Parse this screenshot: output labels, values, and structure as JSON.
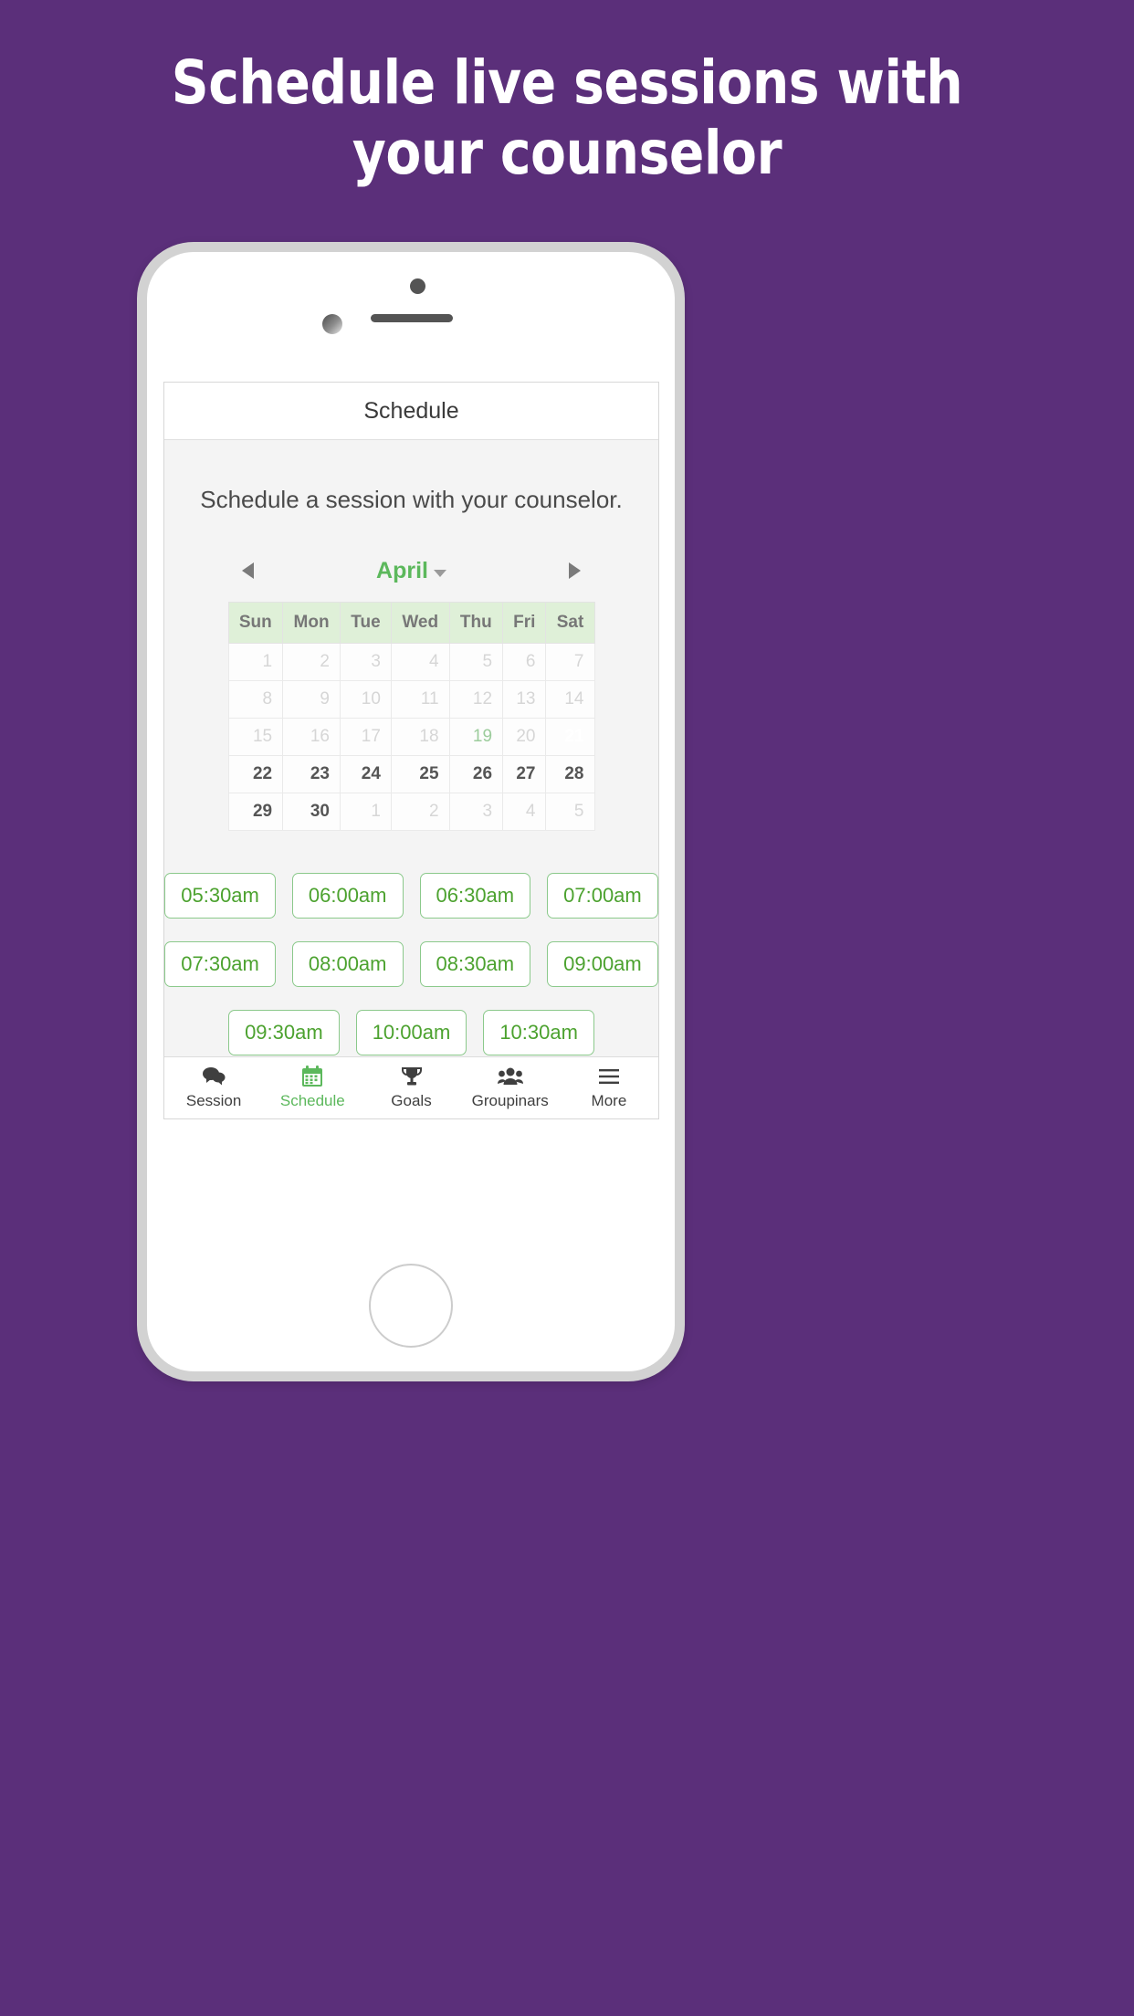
{
  "theme": {
    "background": "#5b2f7a",
    "accent_green": "#5cb85c",
    "selected_green": "#4ca22f",
    "header_green_bg": "#dff0d8"
  },
  "headline": "Schedule live sessions with your counselor",
  "phone": {
    "camera_icon": "camera-dot",
    "speaker_icon": "speaker-grill",
    "home_button": "home-button"
  },
  "app": {
    "header_title": "Schedule",
    "subtitle": "Schedule a session with your counselor.",
    "calendar": {
      "prev_icon": "chevron-left-icon",
      "next_icon": "chevron-right-icon",
      "month": "April",
      "dropdown_icon": "caret-down-icon",
      "weekdays": [
        "Sun",
        "Mon",
        "Tue",
        "Wed",
        "Thu",
        "Fri",
        "Sat"
      ],
      "weeks": [
        [
          {
            "d": "1",
            "s": "past"
          },
          {
            "d": "2",
            "s": "past"
          },
          {
            "d": "3",
            "s": "past"
          },
          {
            "d": "4",
            "s": "past"
          },
          {
            "d": "5",
            "s": "past"
          },
          {
            "d": "6",
            "s": "past"
          },
          {
            "d": "7",
            "s": "past"
          }
        ],
        [
          {
            "d": "8",
            "s": "past"
          },
          {
            "d": "9",
            "s": "past"
          },
          {
            "d": "10",
            "s": "past"
          },
          {
            "d": "11",
            "s": "past"
          },
          {
            "d": "12",
            "s": "past"
          },
          {
            "d": "13",
            "s": "past"
          },
          {
            "d": "14",
            "s": "past"
          }
        ],
        [
          {
            "d": "15",
            "s": "past"
          },
          {
            "d": "16",
            "s": "past"
          },
          {
            "d": "17",
            "s": "past"
          },
          {
            "d": "18",
            "s": "past"
          },
          {
            "d": "19",
            "s": "today"
          },
          {
            "d": "20",
            "s": "past"
          },
          {
            "d": "21",
            "s": "sel"
          }
        ],
        [
          {
            "d": "22",
            "s": "future"
          },
          {
            "d": "23",
            "s": "future"
          },
          {
            "d": "24",
            "s": "future"
          },
          {
            "d": "25",
            "s": "future"
          },
          {
            "d": "26",
            "s": "future"
          },
          {
            "d": "27",
            "s": "future"
          },
          {
            "d": "28",
            "s": "future"
          }
        ],
        [
          {
            "d": "29",
            "s": "future"
          },
          {
            "d": "30",
            "s": "future"
          },
          {
            "d": "1",
            "s": "past"
          },
          {
            "d": "2",
            "s": "past"
          },
          {
            "d": "3",
            "s": "past"
          },
          {
            "d": "4",
            "s": "past"
          },
          {
            "d": "5",
            "s": "past"
          }
        ]
      ]
    },
    "time_slots": [
      [
        "05:30am",
        "06:00am",
        "06:30am",
        "07:00am"
      ],
      [
        "07:30am",
        "08:00am",
        "08:30am",
        "09:00am"
      ],
      [
        "09:30am",
        "10:00am",
        "10:30am"
      ]
    ],
    "tabs": [
      {
        "label": "Session",
        "icon": "chat-bubbles-icon",
        "active": false
      },
      {
        "label": "Schedule",
        "icon": "calendar-icon",
        "active": true
      },
      {
        "label": "Goals",
        "icon": "trophy-icon",
        "active": false
      },
      {
        "label": "Groupinars",
        "icon": "users-icon",
        "active": false
      },
      {
        "label": "More",
        "icon": "hamburger-icon",
        "active": false
      }
    ]
  }
}
